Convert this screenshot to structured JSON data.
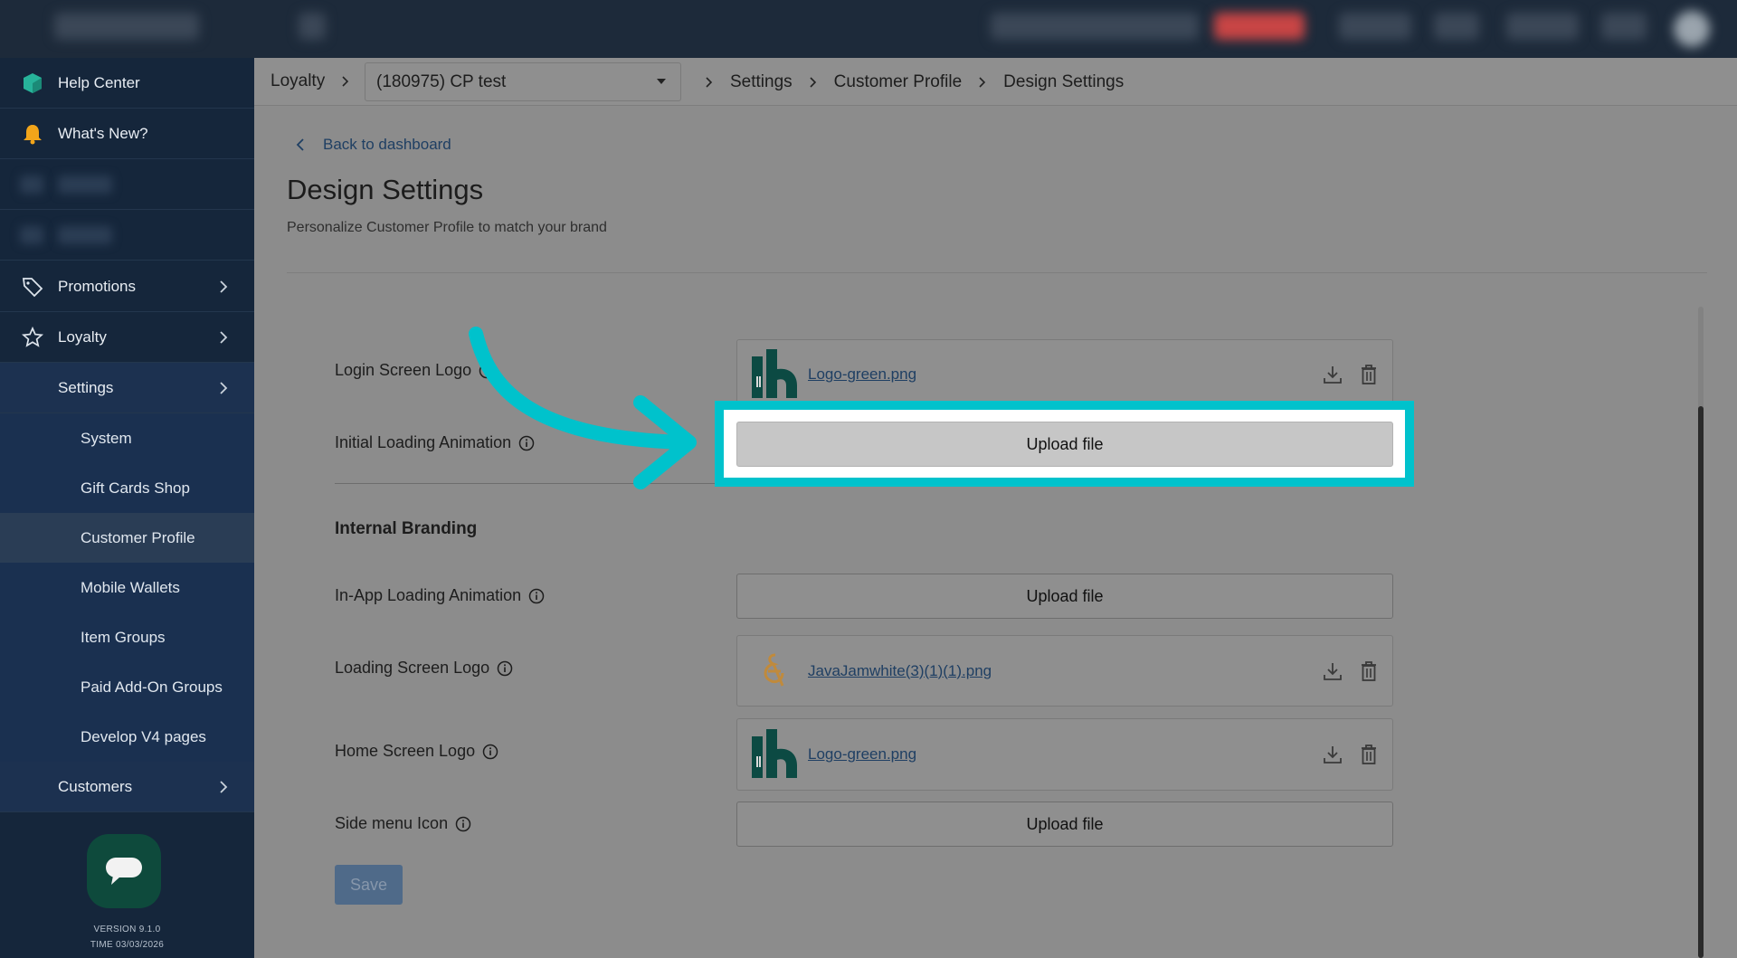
{
  "breadcrumb": {
    "root": "Loyalty",
    "store": "(180975) CP test",
    "settings": "Settings",
    "customer_profile": "Customer Profile",
    "design_settings": "Design Settings"
  },
  "sidebar": {
    "help_center": "Help Center",
    "whats_new": "What's New?",
    "promotions": "Promotions",
    "loyalty": "Loyalty",
    "settings": "Settings",
    "sub_items": [
      "System",
      "Gift Cards Shop",
      "Customer Profile",
      "Mobile Wallets",
      "Item Groups",
      "Paid Add-On Groups",
      "Develop V4 pages"
    ],
    "customers": "Customers",
    "version": "VERSION 9.1.0",
    "time": "TIME 03/03/2026"
  },
  "main": {
    "back": "Back to dashboard",
    "title": "Design Settings",
    "subtitle": "Personalize Customer Profile to match your brand",
    "fields": {
      "login_logo": {
        "label": "Login Screen Logo",
        "file": "Logo-green.png"
      },
      "initial_anim": {
        "label": "Initial Loading Animation",
        "button": "Upload file"
      },
      "internal_branding": "Internal Branding",
      "inapp_anim": {
        "label": "In-App Loading Animation",
        "button": "Upload file"
      },
      "loading_logo": {
        "label": "Loading Screen Logo",
        "file": "JavaJamwhite(3)(1)(1).png"
      },
      "home_logo": {
        "label": "Home Screen Logo",
        "file": "Logo-green.png"
      },
      "side_menu": {
        "label": "Side menu Icon",
        "button": "Upload file"
      }
    },
    "save": "Save"
  },
  "colors": {
    "highlight": "#00c2cc",
    "sidebar": "#15263b",
    "topbar": "#1d2a3a",
    "link": "#1f3f63"
  }
}
